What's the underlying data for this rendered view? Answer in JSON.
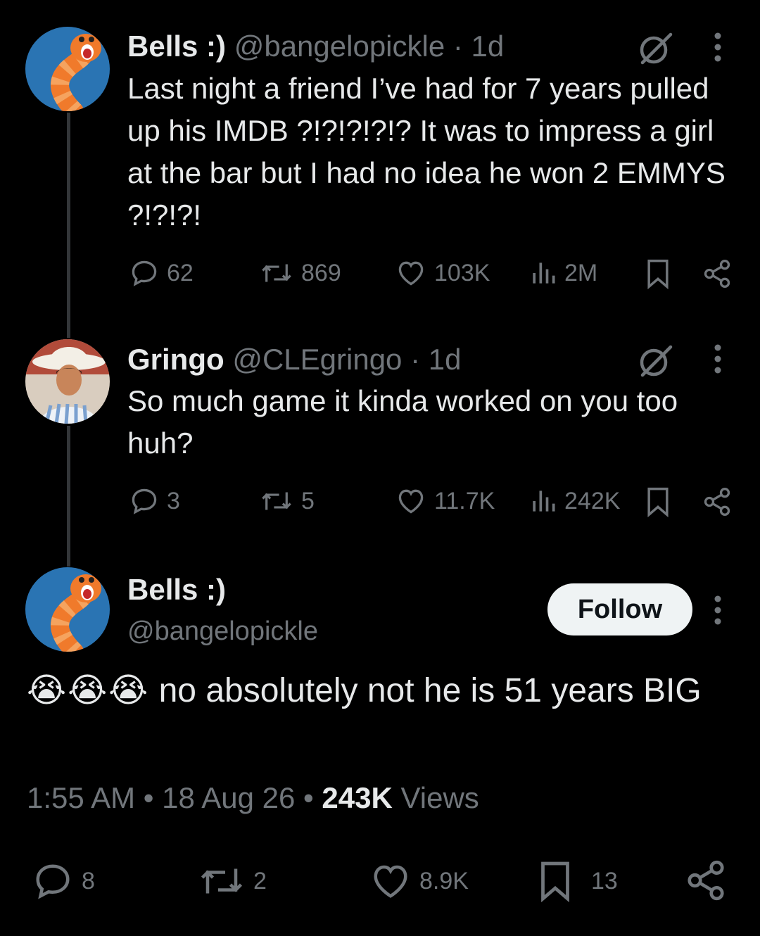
{
  "tweets": [
    {
      "name": "Bells :)",
      "handle": "@bangelopickle",
      "time": "1d",
      "text": "Last night a friend I’ve had for 7 years pulled up his IMDB ?!?!?!?!? It was to impress a girl at the bar but I had no idea he won 2 EMMYS ?!?!?!",
      "replies": "62",
      "reposts": "869",
      "likes": "103K",
      "views": "2M"
    },
    {
      "name": "Gringo",
      "handle": "@CLEgringo",
      "time": "1d",
      "text": "So much game it kinda worked on you too huh?",
      "replies": "3",
      "reposts": "5",
      "likes": "11.7K",
      "views": "242K"
    }
  ],
  "main_tweet": {
    "name": "Bells :)",
    "handle": "@bangelopickle",
    "follow_label": "Follow",
    "emoji": "😭😭😭",
    "text": "no absolutely not he is 51 years BIG",
    "time": "1:55 AM",
    "date": "18 Aug 26",
    "views_count": "243K",
    "views_label": "Views",
    "replies": "8",
    "reposts": "2",
    "likes": "8.9K",
    "bookmarks": "13"
  },
  "separator": "·",
  "bullet": "•",
  "colors": {
    "background": "#000000",
    "text": "#e7e9ea",
    "muted": "#71767b",
    "thread_line": "#333639"
  }
}
